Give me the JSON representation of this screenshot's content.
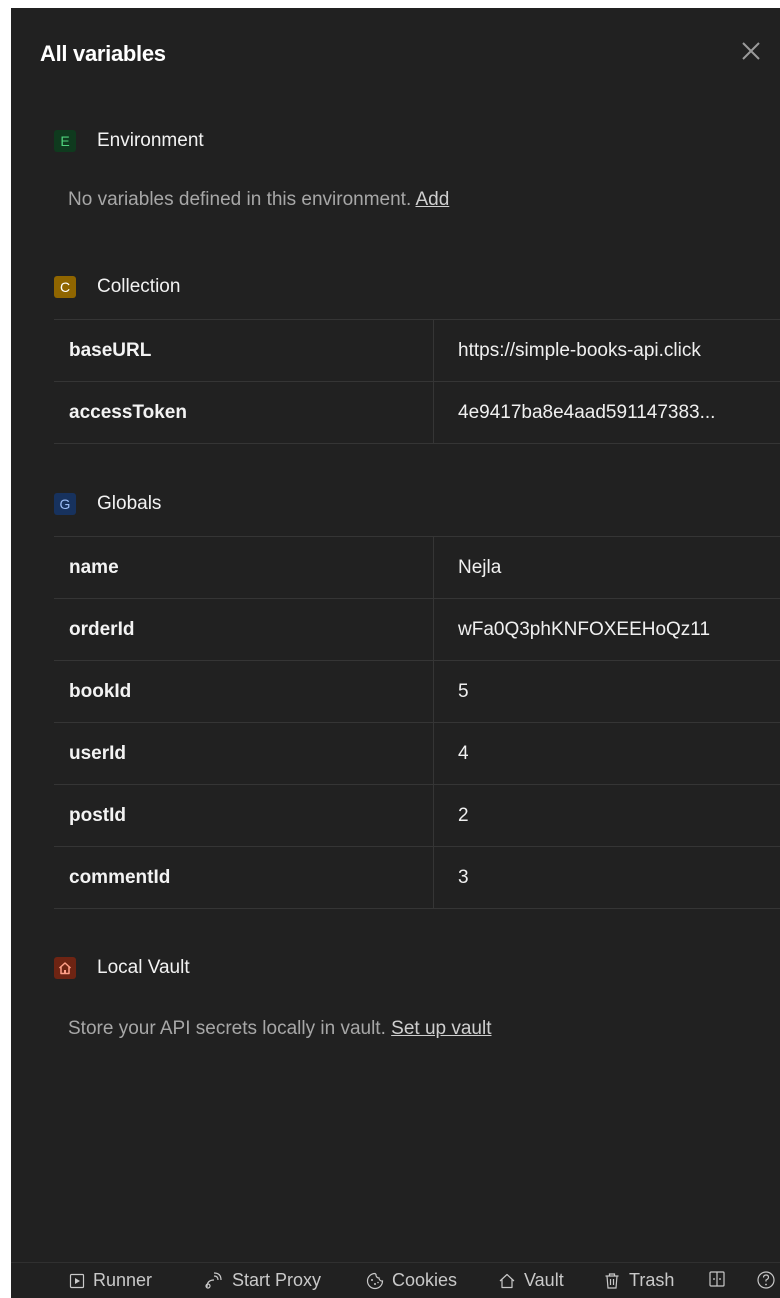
{
  "panel": {
    "title": "All variables",
    "close_icon": "close-icon"
  },
  "environment": {
    "badge": "E",
    "label": "Environment",
    "empty_text": "No variables defined in this environment.",
    "add_link": "Add"
  },
  "collection": {
    "badge": "C",
    "label": "Collection",
    "rows": [
      {
        "key": "baseURL",
        "value": "https://simple-books-api.click"
      },
      {
        "key": "accessToken",
        "value": "4e9417ba8e4aad591147383..."
      }
    ]
  },
  "globals": {
    "badge": "G",
    "label": "Globals",
    "rows": [
      {
        "key": "name",
        "value": "Nejla"
      },
      {
        "key": "orderId",
        "value": "wFa0Q3phKNFOXEEHoQz11"
      },
      {
        "key": "bookId",
        "value": "5"
      },
      {
        "key": "userId",
        "value": "4"
      },
      {
        "key": "postId",
        "value": "2"
      },
      {
        "key": "commentId",
        "value": "3"
      }
    ]
  },
  "vault": {
    "icon": "home-icon",
    "label": "Local Vault",
    "text": "Store your API secrets locally in vault.",
    "setup_link": "Set up vault"
  },
  "footer": {
    "runner": "Runner",
    "start_proxy": "Start Proxy",
    "cookies": "Cookies",
    "vault": "Vault",
    "trash": "Trash"
  },
  "colors": {
    "panel_bg": "#212121",
    "environment_badge": "#0f3a1e",
    "collection_badge": "#8f6500",
    "globals_badge": "#17325e",
    "vault_badge": "#6e2413"
  }
}
